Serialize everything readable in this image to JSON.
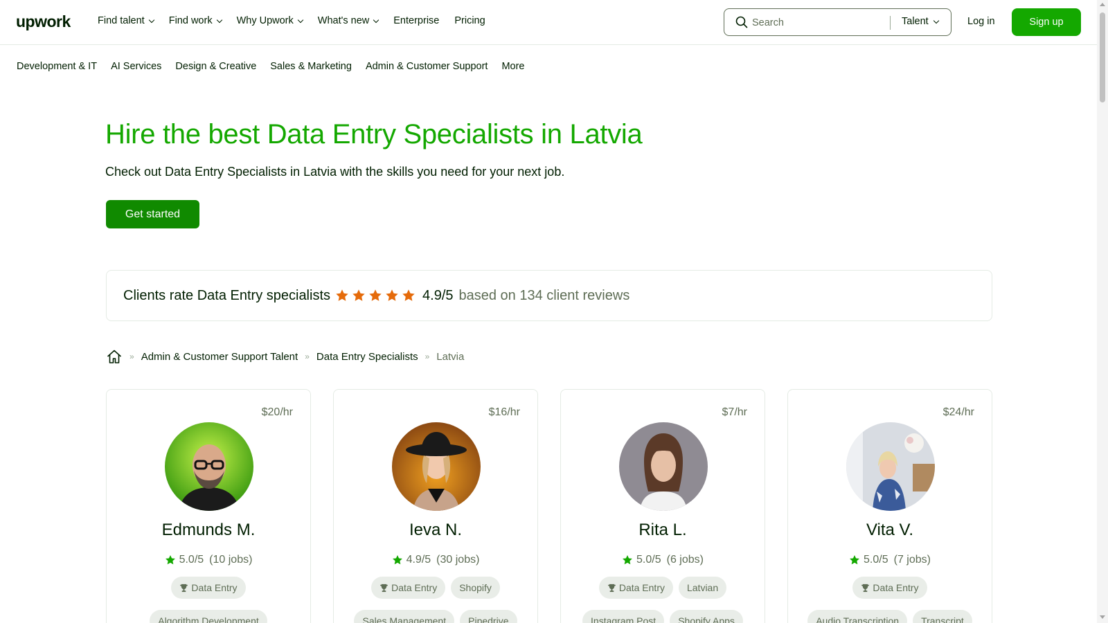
{
  "brand": {
    "logo": "upwork"
  },
  "colors": {
    "accent": "#14a800",
    "dark_green": "#108a00",
    "star": "#e56b0b",
    "text": "#001e00",
    "muted": "#5e6d55"
  },
  "nav": {
    "items": [
      "Find talent",
      "Find work",
      "Why Upwork",
      "What's new",
      "Enterprise",
      "Pricing"
    ],
    "search": {
      "placeholder": "Search",
      "scope": "Talent"
    },
    "login": "Log in",
    "signup": "Sign up"
  },
  "categories": [
    "Development & IT",
    "AI Services",
    "Design & Creative",
    "Sales & Marketing",
    "Admin & Customer Support",
    "More"
  ],
  "hero": {
    "title": "Hire the best Data Entry Specialists in Latvia",
    "subtitle": "Check out Data Entry Specialists in Latvia with the skills you need for your next job.",
    "cta": "Get started"
  },
  "rating": {
    "label": "Clients rate Data Entry specialists",
    "stars": 5,
    "value": "4.9/5",
    "reviews_text": "based on 134 client reviews"
  },
  "breadcrumb": {
    "home_icon": "home-icon",
    "items": [
      "Admin & Customer Support Talent",
      "Data Entry Specialists",
      "Latvia"
    ]
  },
  "freelancers": [
    {
      "name": "Edmunds M.",
      "rate": "$20/hr",
      "score": "5.0/5",
      "jobs": "(10 jobs)",
      "top_tag": "Data Entry",
      "tags_row1": [],
      "tags_row2": [
        "Algorithm Development"
      ]
    },
    {
      "name": "Ieva N.",
      "rate": "$16/hr",
      "score": "4.9/5",
      "jobs": "(30 jobs)",
      "top_tag": "Data Entry",
      "tags_row1": [
        "Shopify"
      ],
      "tags_row2": [
        "Sales Management",
        "Pipedrive"
      ]
    },
    {
      "name": "Rita L.",
      "rate": "$7/hr",
      "score": "5.0/5",
      "jobs": "(6 jobs)",
      "top_tag": "Data Entry",
      "tags_row1": [
        "Latvian"
      ],
      "tags_row2": [
        "Instagram Post",
        "Shopify Apps"
      ]
    },
    {
      "name": "Vita V.",
      "rate": "$24/hr",
      "score": "5.0/5",
      "jobs": "(7 jobs)",
      "top_tag": "Data Entry",
      "tags_row1": [],
      "tags_row2": [
        "Audio Transcription",
        "Transcript"
      ]
    }
  ]
}
